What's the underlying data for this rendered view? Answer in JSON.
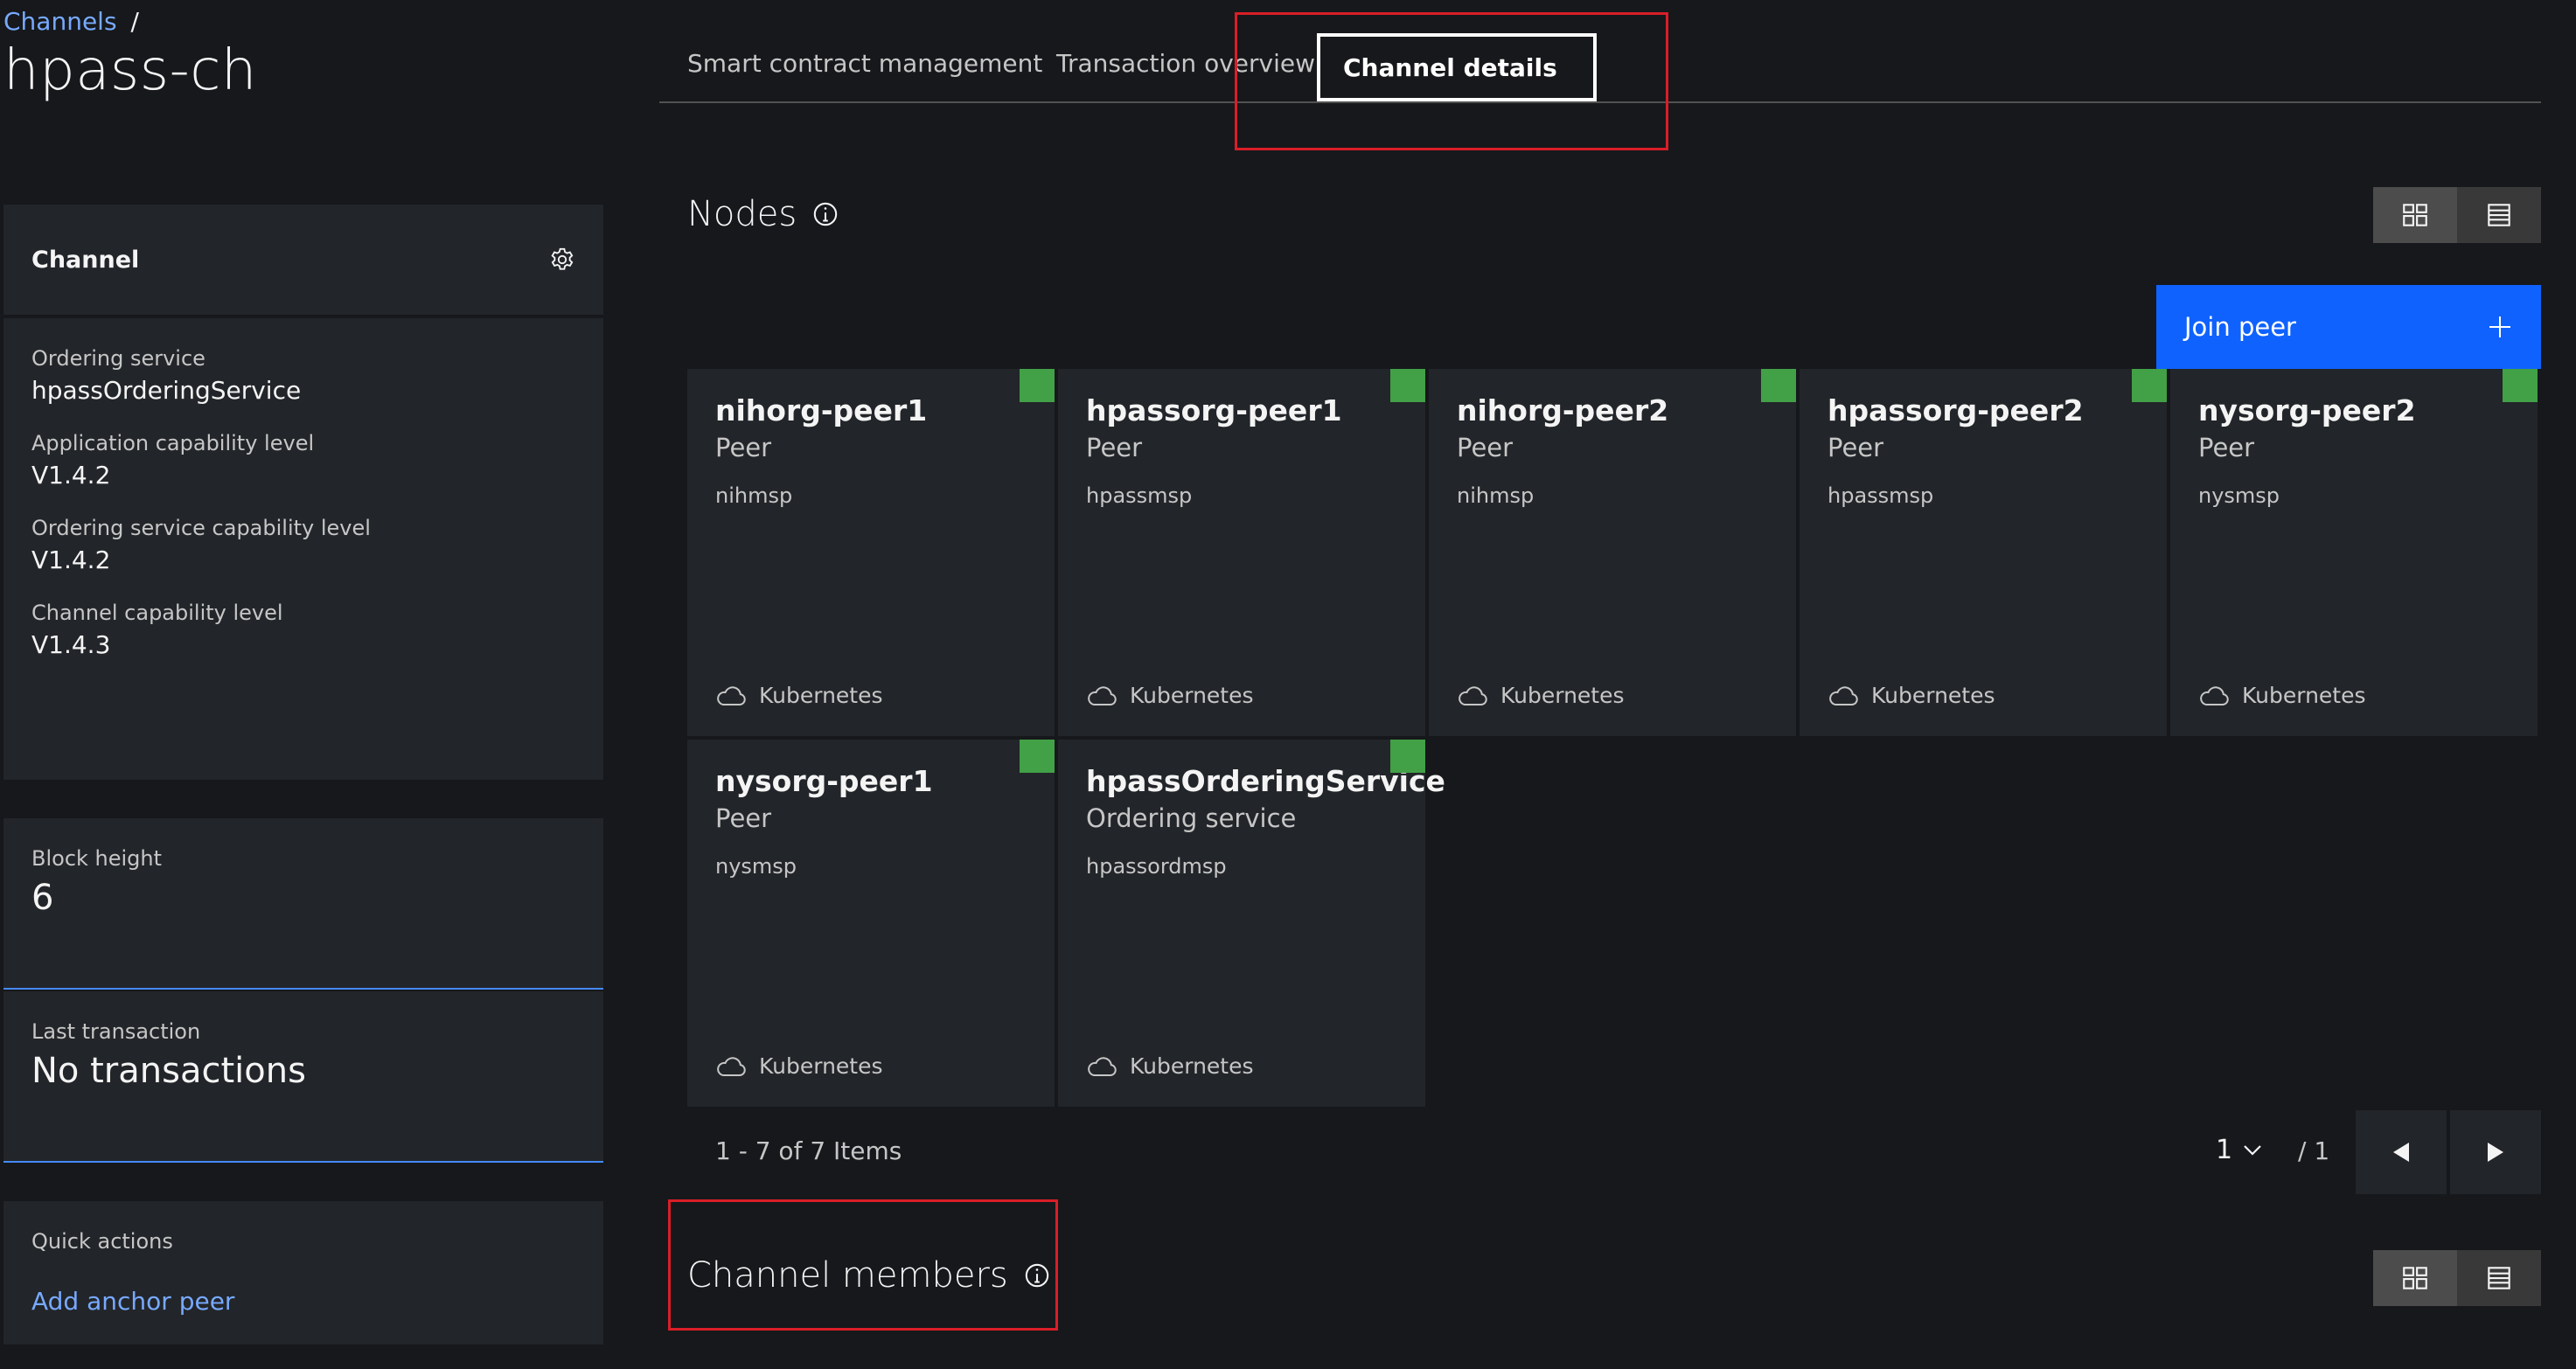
{
  "breadcrumb": {
    "link": "Channels",
    "separator": "/"
  },
  "page_title": "hpass-ch",
  "tabs": [
    {
      "label": "Smart contract management"
    },
    {
      "label": "Transaction overview"
    },
    {
      "label": "Channel details",
      "active": true
    }
  ],
  "channel_panel": {
    "title": "Channel",
    "items": [
      {
        "label": "Ordering service",
        "value": "hpassOrderingService"
      },
      {
        "label": "Application capability level",
        "value": "V1.4.2"
      },
      {
        "label": "Ordering service capability level",
        "value": "V1.4.2"
      },
      {
        "label": "Channel capability level",
        "value": "V1.4.3"
      }
    ]
  },
  "block_height": {
    "label": "Block height",
    "value": "6"
  },
  "last_transaction": {
    "label": "Last transaction",
    "value": "No transactions"
  },
  "quick_actions": {
    "label": "Quick actions",
    "link": "Add anchor peer"
  },
  "nodes_section": {
    "title": "Nodes",
    "join_label": "Join peer"
  },
  "nodes": [
    {
      "name": "nihorg-peer1",
      "type": "Peer",
      "msp": "nihmsp",
      "location": "Kubernetes"
    },
    {
      "name": "hpassorg-peer1",
      "type": "Peer",
      "msp": "hpassmsp",
      "location": "Kubernetes"
    },
    {
      "name": "nihorg-peer2",
      "type": "Peer",
      "msp": "nihmsp",
      "location": "Kubernetes"
    },
    {
      "name": "hpassorg-peer2",
      "type": "Peer",
      "msp": "hpassmsp",
      "location": "Kubernetes"
    },
    {
      "name": "nysorg-peer2",
      "type": "Peer",
      "msp": "nysmsp",
      "location": "Kubernetes"
    },
    {
      "name": "nysorg-peer1",
      "type": "Peer",
      "msp": "nysmsp",
      "location": "Kubernetes"
    },
    {
      "name": "hpassOrderingService",
      "type": "Ordering service",
      "msp": "hpassordmsp",
      "location": "Kubernetes"
    }
  ],
  "pagination": {
    "items_text": "1 - 7 of 7 Items",
    "current_page": "1",
    "total_pages": "/ 1"
  },
  "members_section": {
    "title": "Channel members"
  },
  "colors": {
    "status_ok": "#42a047",
    "primary": "#0f62fe",
    "highlight": "#da1e28",
    "link": "#78a9ff"
  }
}
